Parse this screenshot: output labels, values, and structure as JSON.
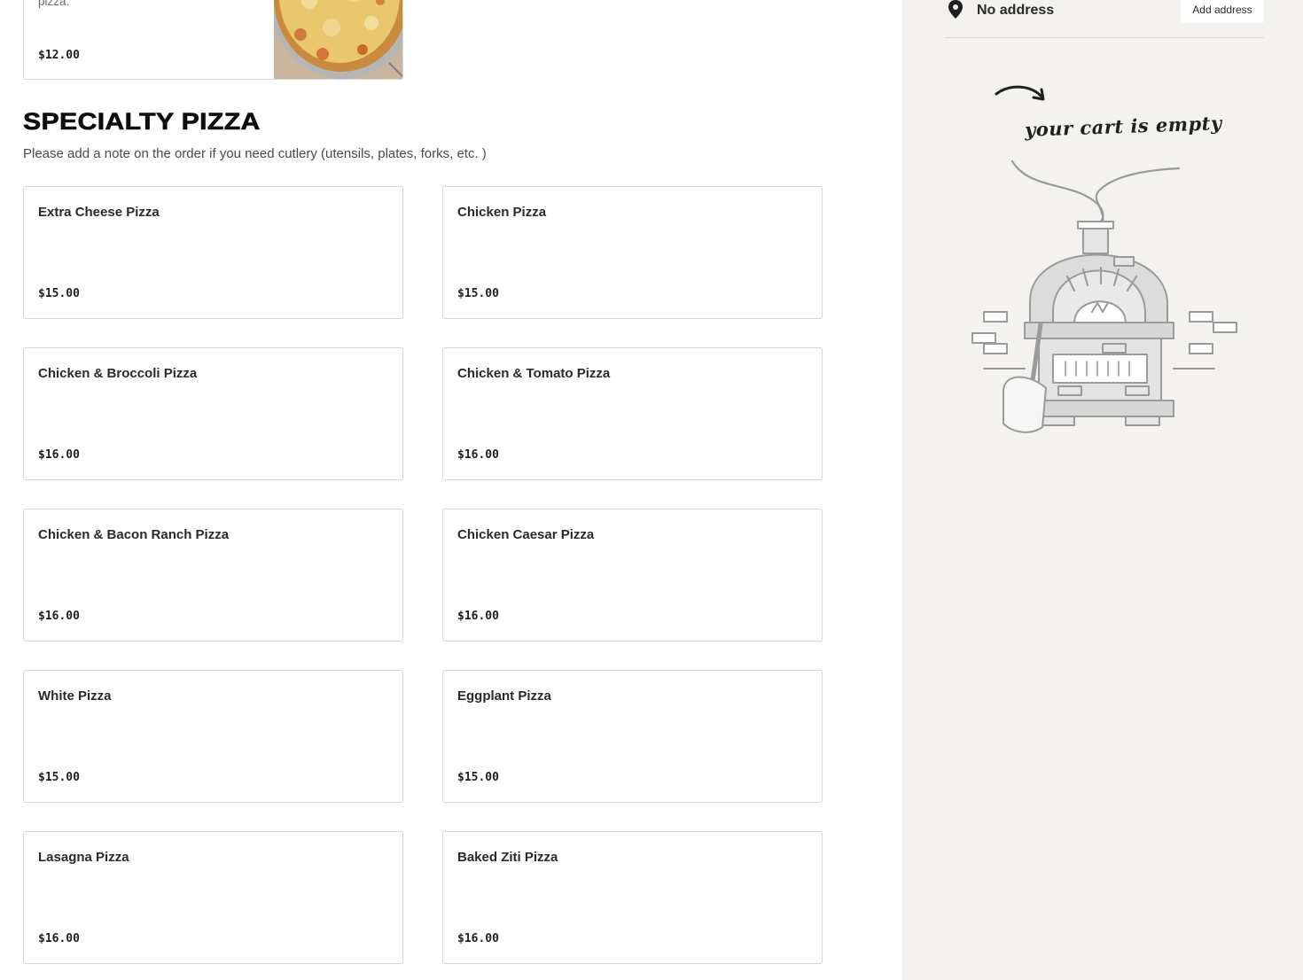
{
  "top_item": {
    "description": "pizza.",
    "price": "$12.00"
  },
  "specialty": {
    "title": "SPECIALTY PIZZA",
    "note": "Please add a note on the order if you need cutlery (utensils, plates, forks, etc. )",
    "items": [
      {
        "name": "Extra Cheese Pizza",
        "price": "$15.00"
      },
      {
        "name": "Chicken Pizza",
        "price": "$15.00"
      },
      {
        "name": "Chicken & Broccoli Pizza",
        "price": "$16.00"
      },
      {
        "name": "Chicken & Tomato Pizza",
        "price": "$16.00"
      },
      {
        "name": "Chicken & Bacon Ranch Pizza",
        "price": "$16.00"
      },
      {
        "name": "Chicken Caesar Pizza",
        "price": "$16.00"
      },
      {
        "name": "White Pizza",
        "price": "$15.00"
      },
      {
        "name": "Eggplant Pizza",
        "price": "$15.00"
      },
      {
        "name": "Lasagna Pizza",
        "price": "$16.00"
      },
      {
        "name": "Baked Ziti Pizza",
        "price": "$16.00"
      }
    ]
  },
  "cart": {
    "address_text": "No address",
    "add_address_label": "Add address",
    "empty_text": "your cart is empty"
  },
  "icons": {
    "location": "map-pin-icon",
    "illustration": "pizza-oven-illustration",
    "arrow": "curved-arrow-icon"
  }
}
